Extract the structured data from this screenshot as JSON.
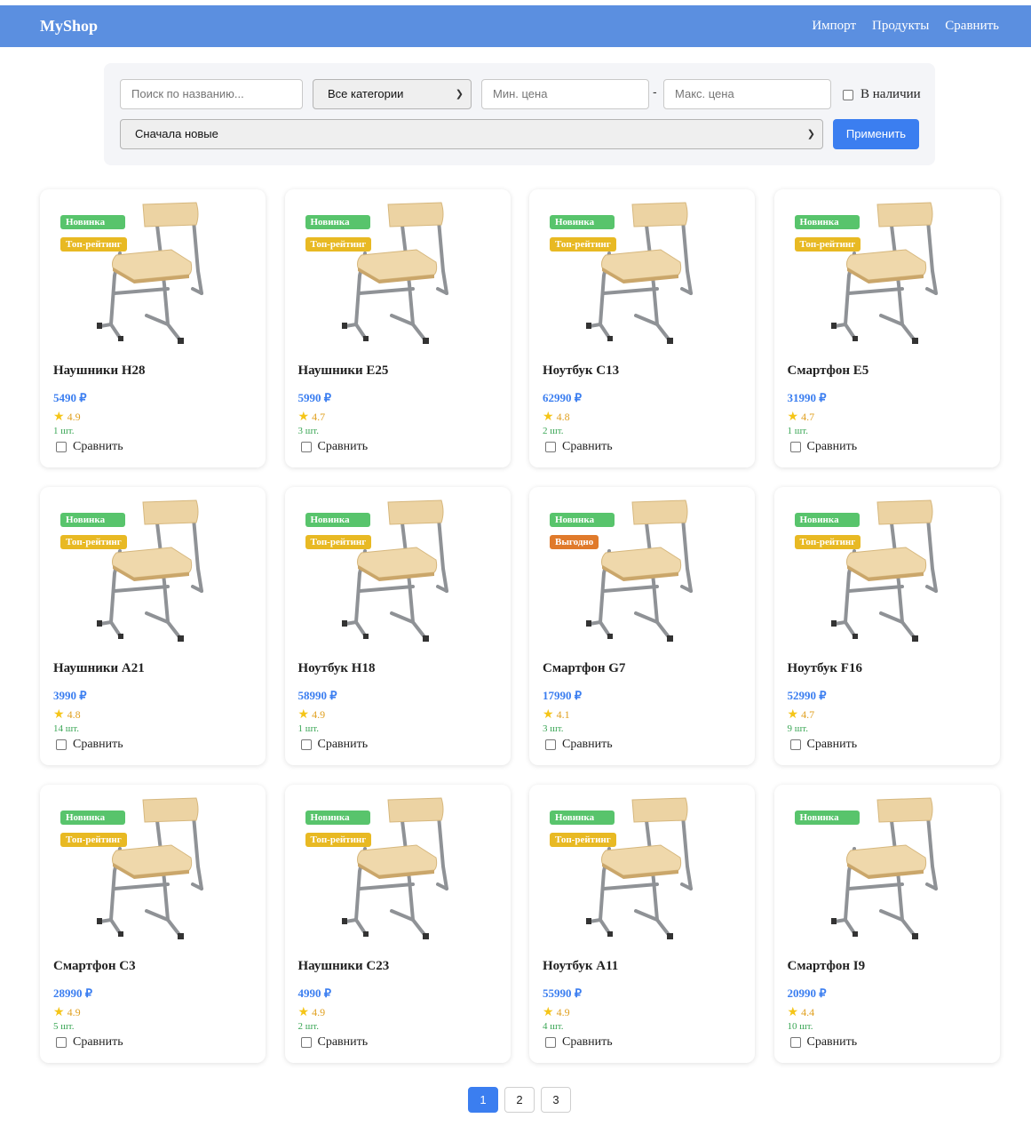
{
  "nav": {
    "brand": "MyShop",
    "links": [
      "Импорт",
      "Продукты",
      "Сравнить"
    ]
  },
  "filters": {
    "search_placeholder": "Поиск по названию...",
    "category_selected": "Все категории",
    "min_price_placeholder": "Мин. цена",
    "max_price_placeholder": "Макс. цена",
    "in_stock_label": "В наличии",
    "sort_selected": "Сначала новые",
    "apply_label": "Применить"
  },
  "compare_label": "Сравнить",
  "products": [
    {
      "name": "Наушники H28",
      "price": "5490 ₽",
      "rating": "4.9",
      "stock": "1 шт.",
      "badges": [
        {
          "label": "Новинка",
          "kind": "new"
        },
        {
          "label": "Топ-рейтинг",
          "kind": "top"
        }
      ]
    },
    {
      "name": "Наушники E25",
      "price": "5990 ₽",
      "rating": "4.7",
      "stock": "3 шт.",
      "badges": [
        {
          "label": "Новинка",
          "kind": "new"
        },
        {
          "label": "Топ-рейтинг",
          "kind": "top"
        }
      ]
    },
    {
      "name": "Ноутбук C13",
      "price": "62990 ₽",
      "rating": "4.8",
      "stock": "2 шт.",
      "badges": [
        {
          "label": "Новинка",
          "kind": "new"
        },
        {
          "label": "Топ-рейтинг",
          "kind": "top"
        }
      ]
    },
    {
      "name": "Смартфон E5",
      "price": "31990 ₽",
      "rating": "4.7",
      "stock": "1 шт.",
      "badges": [
        {
          "label": "Новинка",
          "kind": "new"
        },
        {
          "label": "Топ-рейтинг",
          "kind": "top"
        }
      ]
    },
    {
      "name": "Наушники A21",
      "price": "3990 ₽",
      "rating": "4.8",
      "stock": "14 шт.",
      "badges": [
        {
          "label": "Новинка",
          "kind": "new"
        },
        {
          "label": "Топ-рейтинг",
          "kind": "top"
        }
      ]
    },
    {
      "name": "Ноутбук H18",
      "price": "58990 ₽",
      "rating": "4.9",
      "stock": "1 шт.",
      "badges": [
        {
          "label": "Новинка",
          "kind": "new"
        },
        {
          "label": "Топ-рейтинг",
          "kind": "top"
        }
      ]
    },
    {
      "name": "Смартфон G7",
      "price": "17990 ₽",
      "rating": "4.1",
      "stock": "3 шт.",
      "badges": [
        {
          "label": "Новинка",
          "kind": "new"
        },
        {
          "label": "Выгодно",
          "kind": "deal"
        }
      ]
    },
    {
      "name": "Ноутбук F16",
      "price": "52990 ₽",
      "rating": "4.7",
      "stock": "9 шт.",
      "badges": [
        {
          "label": "Новинка",
          "kind": "new"
        },
        {
          "label": "Топ-рейтинг",
          "kind": "top"
        }
      ]
    },
    {
      "name": "Смартфон C3",
      "price": "28990 ₽",
      "rating": "4.9",
      "stock": "5 шт.",
      "badges": [
        {
          "label": "Новинка",
          "kind": "new"
        },
        {
          "label": "Топ-рейтинг",
          "kind": "top"
        }
      ]
    },
    {
      "name": "Наушники C23",
      "price": "4990 ₽",
      "rating": "4.9",
      "stock": "2 шт.",
      "badges": [
        {
          "label": "Новинка",
          "kind": "new"
        },
        {
          "label": "Топ-рейтинг",
          "kind": "top"
        }
      ]
    },
    {
      "name": "Ноутбук A11",
      "price": "55990 ₽",
      "rating": "4.9",
      "stock": "4 шт.",
      "badges": [
        {
          "label": "Новинка",
          "kind": "new"
        },
        {
          "label": "Топ-рейтинг",
          "kind": "top"
        }
      ]
    },
    {
      "name": "Смартфон I9",
      "price": "20990 ₽",
      "rating": "4.4",
      "stock": "10 шт.",
      "badges": [
        {
          "label": "Новинка",
          "kind": "new"
        }
      ]
    }
  ],
  "pagination": {
    "pages": [
      "1",
      "2",
      "3"
    ],
    "active": "1"
  },
  "colors": {
    "navbar": "#5b8fe0",
    "accent": "#3b7ef0",
    "badge_new": "#58c46c",
    "badge_top": "#e8b923",
    "badge_deal": "#e07a2b",
    "stock": "#3aa655",
    "rating": "#e0a020"
  }
}
